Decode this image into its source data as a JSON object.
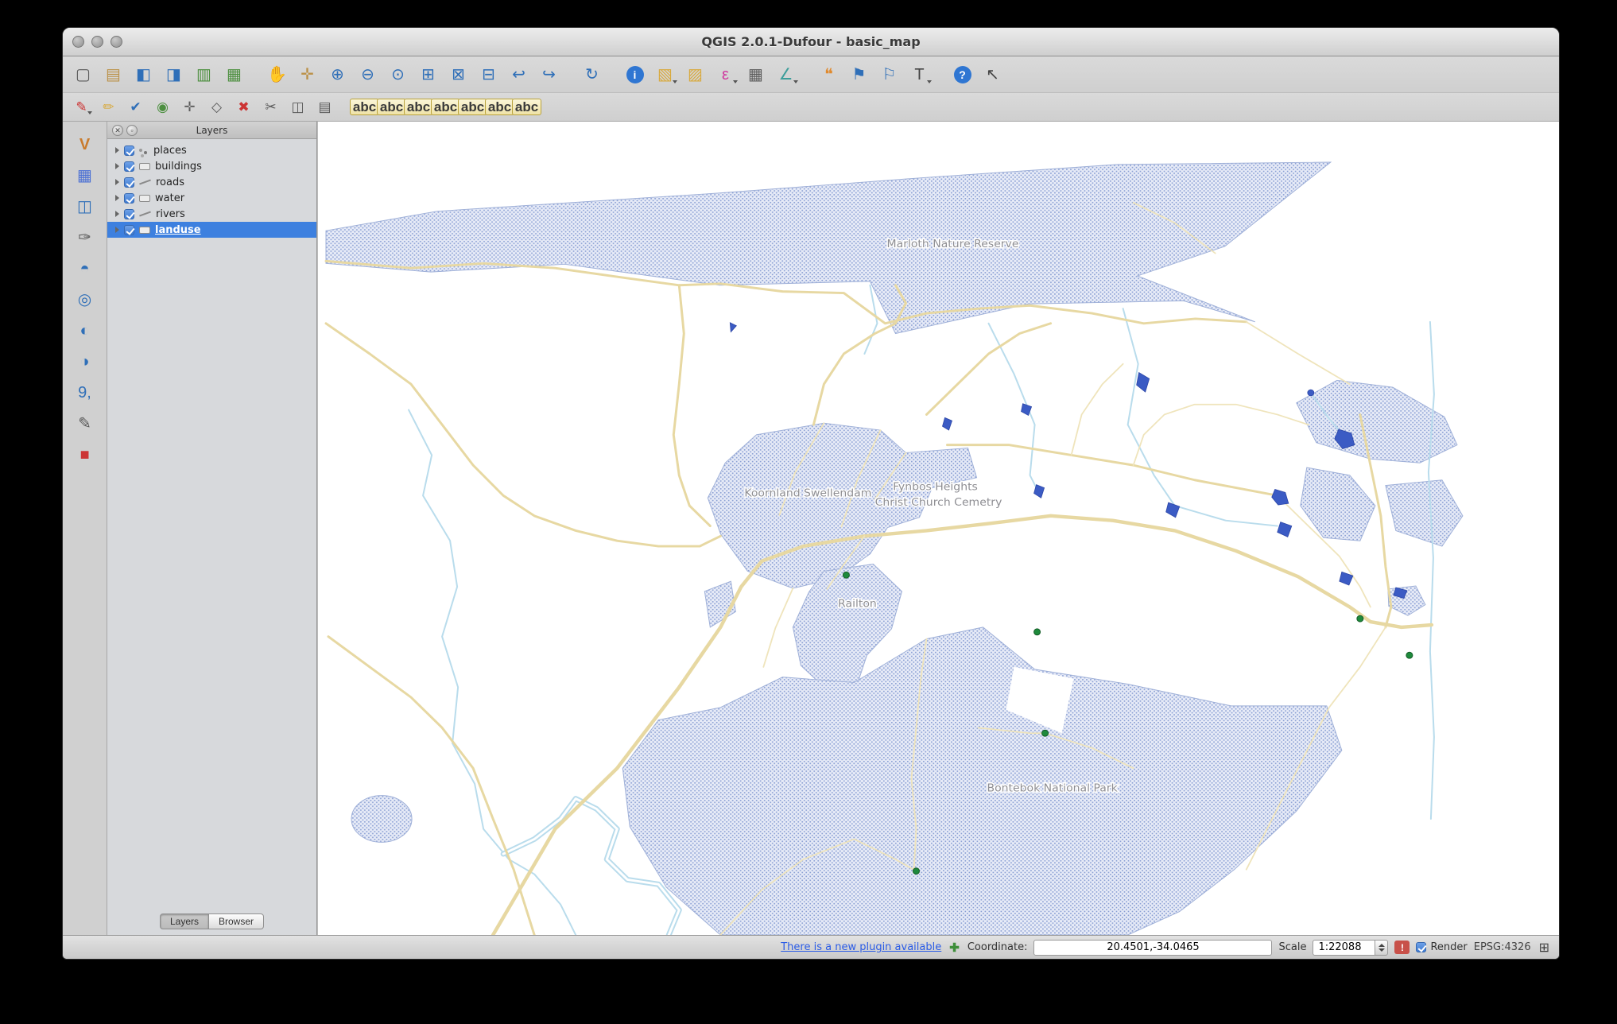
{
  "colors": {
    "selection": "#3d80df",
    "landuse-bg": "#e7ebf7",
    "landuse-dot": "#8ba0d4",
    "road": "#e7d8a2",
    "road-minor": "#efe4bb",
    "river": "#b9dcec",
    "water": "#3b5bc4",
    "place-dot": "#1e8a3c",
    "label": "#8e8e93"
  },
  "window": {
    "title": "QGIS 2.0.1-Dufour - basic_map"
  },
  "toolbar_main": [
    {
      "name": "new-project-button",
      "icon": "new-project-icon",
      "glyph": "▢",
      "cls": "ic-gray"
    },
    {
      "name": "open-project-button",
      "icon": "open-project-icon",
      "glyph": "▤",
      "cls": "ic-tan"
    },
    {
      "name": "save-project-button",
      "icon": "save-project-icon",
      "glyph": "◧",
      "cls": "ic-blue"
    },
    {
      "name": "save-project-as-button",
      "icon": "save-project-as-icon",
      "glyph": "◨",
      "cls": "ic-blue"
    },
    {
      "name": "new-composer-button",
      "icon": "new-composer-icon",
      "glyph": "▥",
      "cls": "ic-green"
    },
    {
      "name": "composer-manager-button",
      "icon": "composer-manager-icon",
      "glyph": "▦",
      "cls": "ic-green"
    },
    {
      "name": "pan-map-button",
      "icon": "pan-hand-icon",
      "glyph": "✋",
      "cls": "ic-tan",
      "cls2": "group-start"
    },
    {
      "name": "pan-to-selection-button",
      "icon": "pan-selection-icon",
      "glyph": "✛",
      "cls": "ic-tan"
    },
    {
      "name": "zoom-in-button",
      "icon": "zoom-in-icon",
      "glyph": "⊕",
      "cls": "ic-blue"
    },
    {
      "name": "zoom-out-button",
      "icon": "zoom-out-icon",
      "glyph": "⊖",
      "cls": "ic-blue"
    },
    {
      "name": "zoom-native-button",
      "icon": "zoom-native-icon",
      "glyph": "⊙",
      "cls": "ic-blue"
    },
    {
      "name": "zoom-full-button",
      "icon": "zoom-full-icon",
      "glyph": "⊞",
      "cls": "ic-blue"
    },
    {
      "name": "zoom-to-selection-button",
      "icon": "zoom-selection-icon",
      "glyph": "⊠",
      "cls": "ic-blue"
    },
    {
      "name": "zoom-to-layer-button",
      "icon": "zoom-layer-icon",
      "glyph": "⊟",
      "cls": "ic-blue"
    },
    {
      "name": "zoom-last-button",
      "icon": "zoom-last-icon",
      "glyph": "↩",
      "cls": "ic-blue"
    },
    {
      "name": "zoom-next-button",
      "icon": "zoom-next-icon",
      "glyph": "↪",
      "cls": "ic-blue"
    },
    {
      "name": "refresh-map-button",
      "icon": "refresh-icon",
      "glyph": "↻",
      "cls": "ic-blue",
      "cls2": "group-start"
    },
    {
      "name": "identify-features-button",
      "icon": "identify-icon",
      "glyph": "i",
      "cls": "ic-round",
      "cls2": "group-start"
    },
    {
      "name": "select-features-button",
      "icon": "select-rectangle-icon",
      "glyph": "▧",
      "cls": "ic-yellow",
      "cls2": "has-caret"
    },
    {
      "name": "deselect-features-button",
      "icon": "deselect-icon",
      "glyph": "▨",
      "cls": "ic-yellow"
    },
    {
      "name": "run-feature-action-button",
      "icon": "feature-action-icon",
      "glyph": "ε",
      "cls": "ic-pink",
      "cls2": "has-caret"
    },
    {
      "name": "open-attribute-table-button",
      "icon": "attribute-table-icon",
      "glyph": "▦",
      "cls": "ic-gray"
    },
    {
      "name": "measure-button",
      "icon": "measure-icon",
      "glyph": "∠",
      "cls": "ic-teal",
      "cls2": "has-caret"
    },
    {
      "name": "map-tips-button",
      "icon": "map-tips-icon",
      "glyph": "❝",
      "cls": "ic-orange",
      "cls2": "group-start"
    },
    {
      "name": "new-bookmark-button",
      "icon": "new-bookmark-icon",
      "glyph": "⚑",
      "cls": "ic-blue"
    },
    {
      "name": "show-bookmarks-button",
      "icon": "show-bookmarks-icon",
      "glyph": "⚐",
      "cls": "ic-blue"
    },
    {
      "name": "text-annotation-button",
      "icon": "text-annotation-icon",
      "glyph": "T",
      "cls": "ic-dark",
      "cls2": "has-caret"
    },
    {
      "name": "help-button",
      "icon": "help-icon",
      "glyph": "?",
      "cls": "ic-round",
      "cls2": "group-start"
    },
    {
      "name": "whats-this-button",
      "icon": "whats-this-icon",
      "glyph": "↖",
      "cls": "ic-dark"
    }
  ],
  "toolbar_edit": [
    {
      "name": "current-edits-button",
      "icon": "current-edits-icon",
      "glyph": "✎",
      "cls": "ic-red",
      "cls2": "has-caret"
    },
    {
      "name": "toggle-editing-button",
      "icon": "toggle-editing-icon",
      "glyph": "✏",
      "cls": "ic-yellow"
    },
    {
      "name": "save-layer-edits-button",
      "icon": "save-edits-icon",
      "glyph": "✔",
      "cls": "ic-blue"
    },
    {
      "name": "add-feature-button",
      "icon": "add-feature-icon",
      "glyph": "◉",
      "cls": "ic-green"
    },
    {
      "name": "move-feature-button",
      "icon": "move-feature-icon",
      "glyph": "✛",
      "cls": "ic-gray"
    },
    {
      "name": "node-tool-button",
      "icon": "node-tool-icon",
      "glyph": "◇",
      "cls": "ic-gray"
    },
    {
      "name": "delete-selected-button",
      "icon": "delete-selected-icon",
      "glyph": "✖",
      "cls": "ic-red"
    },
    {
      "name": "cut-features-button",
      "icon": "cut-features-icon",
      "glyph": "✂",
      "cls": "ic-gray"
    },
    {
      "name": "copy-features-button",
      "icon": "copy-features-icon",
      "glyph": "◫",
      "cls": "ic-gray"
    },
    {
      "name": "paste-features-button",
      "icon": "paste-features-icon",
      "glyph": "▤",
      "cls": "ic-gray"
    },
    {
      "name": "labeling-button",
      "icon": "labeling-icon",
      "glyph": "abc",
      "cls": "ic-abc",
      "cls2": "group-start"
    },
    {
      "name": "label-settings-button",
      "icon": "label-settings-icon",
      "glyph": "abc",
      "cls": "ic-abc"
    },
    {
      "name": "pin-label-button",
      "icon": "pin-label-icon",
      "glyph": "abc",
      "cls": "ic-abc"
    },
    {
      "name": "highlight-labels-button",
      "icon": "highlight-labels-icon",
      "glyph": "abc",
      "cls": "ic-abc"
    },
    {
      "name": "move-label-button",
      "icon": "move-label-icon",
      "glyph": "abc",
      "cls": "ic-abc"
    },
    {
      "name": "rotate-label-button",
      "icon": "rotate-label-icon",
      "glyph": "abc",
      "cls": "ic-abc"
    },
    {
      "name": "change-label-button",
      "icon": "change-label-icon",
      "glyph": "abc",
      "cls": "ic-abc"
    }
  ],
  "toolbar_layers": [
    {
      "name": "add-vector-layer-button",
      "icon": "add-vector-layer-icon",
      "glyph": "V",
      "cls": "ic-vec"
    },
    {
      "name": "add-raster-layer-button",
      "icon": "add-raster-layer-icon",
      "glyph": "▦",
      "cls": "ic-raster"
    },
    {
      "name": "add-postgis-layer-button",
      "icon": "add-postgis-layer-icon",
      "glyph": "◫",
      "cls": "ic-blue"
    },
    {
      "name": "add-spatialite-layer-button",
      "icon": "add-spatialite-layer-icon",
      "glyph": "✑",
      "cls": "ic-gray"
    },
    {
      "name": "add-mssql-layer-button",
      "icon": "add-mssql-layer-icon",
      "glyph": "◓",
      "cls": "ic-blue"
    },
    {
      "name": "add-wms-layer-button",
      "icon": "add-wms-layer-icon",
      "glyph": "◎",
      "cls": "ic-blue"
    },
    {
      "name": "add-wcs-layer-button",
      "icon": "add-wcs-layer-icon",
      "glyph": "◐",
      "cls": "ic-blue"
    },
    {
      "name": "add-wfs-layer-button",
      "icon": "add-wfs-layer-icon",
      "glyph": "◑",
      "cls": "ic-blue"
    },
    {
      "name": "add-delimited-text-button",
      "icon": "add-delimited-text-icon",
      "glyph": "9,",
      "cls": "ic-blue"
    },
    {
      "name": "new-shapefile-layer-button",
      "icon": "new-shapefile-icon",
      "glyph": "✎",
      "cls": "ic-gray"
    },
    {
      "name": "remove-layer-button",
      "icon": "remove-layer-icon",
      "glyph": "■",
      "cls": "ic-red"
    }
  ],
  "layers_panel": {
    "title": "Layers",
    "close_glyph": "✕",
    "float_glyph": "▫",
    "items": [
      {
        "label": "places",
        "rowName": "layer-row-places",
        "icon": "point-layer-symbol-icon",
        "sym": "sym-point"
      },
      {
        "label": "buildings",
        "rowName": "layer-row-buildings",
        "icon": "polygon-layer-symbol-icon",
        "sym": "sym-poly"
      },
      {
        "label": "roads",
        "rowName": "layer-row-roads",
        "icon": "line-layer-symbol-icon",
        "sym": "sym-line"
      },
      {
        "label": "water",
        "rowName": "layer-row-water",
        "icon": "polygon-layer-symbol-icon",
        "sym": "sym-poly"
      },
      {
        "label": "rivers",
        "rowName": "layer-row-rivers",
        "icon": "line-layer-symbol-icon",
        "sym": "sym-line"
      },
      {
        "label": "landuse",
        "rowName": "layer-row-landuse",
        "icon": "polygon-layer-symbol-icon",
        "sym": "sym-poly",
        "selCls": "selected"
      }
    ],
    "tabs": [
      {
        "label": "Layers",
        "name": "tab-layers",
        "cls": "active"
      },
      {
        "label": "Browser",
        "name": "tab-browser"
      }
    ]
  },
  "map": {
    "labels": [
      {
        "text": "Marloth Nature Reserve"
      },
      {
        "text": "Koornland Swellendam"
      },
      {
        "text": "Fynbos Heights"
      },
      {
        "text": "Christ Church Cemetry"
      },
      {
        "text": "Railton"
      },
      {
        "text": "Bontebok National Park"
      }
    ]
  },
  "status_bar": {
    "plugin_link": "There is a new plugin available",
    "plugin_icon_glyph": "✚",
    "coordinate_label": "Coordinate:",
    "coordinate_value": "20.4501,-34.0465",
    "scale_label": "Scale",
    "scale_value": "1:22088",
    "log_glyph": "!",
    "render_label": "Render",
    "crs": "EPSG:4326",
    "crs_icon_glyph": "⊞"
  }
}
